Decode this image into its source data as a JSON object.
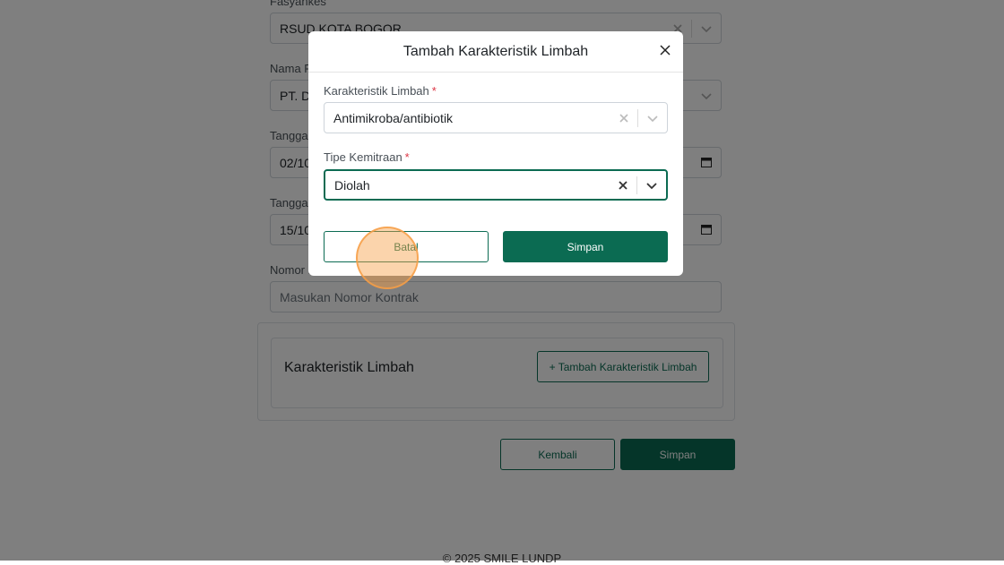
{
  "form": {
    "fasyankes_label": "Fasyankes",
    "fasyankes_value": "RSUD KOTA BOGOR",
    "nama_label": "Nama P",
    "nama_value": "PT. D",
    "tanggal1_label": "Tanggal",
    "tanggal1_value": "02/10/",
    "tanggal2_label": "Tanggal",
    "tanggal2_value": "15/10/",
    "nomor_label": "Nomor K",
    "nomor_placeholder": "Masukan Nomor Kontrak"
  },
  "karakteristik_section": {
    "title": "Karakteristik Limbah",
    "add_button_label": "+  Tambah Karakteristik Limbah"
  },
  "page_actions": {
    "back_label": "Kembali",
    "save_label": "Simpan"
  },
  "footer": {
    "text": "© 2025 SMILE LUNDP"
  },
  "modal": {
    "title": "Tambah Karakteristik Limbah",
    "karakteristik_label": "Karakteristik Limbah",
    "karakteristik_value": "Antimikroba/antibiotik",
    "tipe_label": "Tipe Kemitraan",
    "tipe_value": "Diolah",
    "required_mark": "*",
    "cancel_label": "Batal",
    "save_label": "Simpan"
  },
  "colors": {
    "primary": "#0b6b52",
    "required": "#dc3545",
    "click_indicator": "#f79f46"
  }
}
